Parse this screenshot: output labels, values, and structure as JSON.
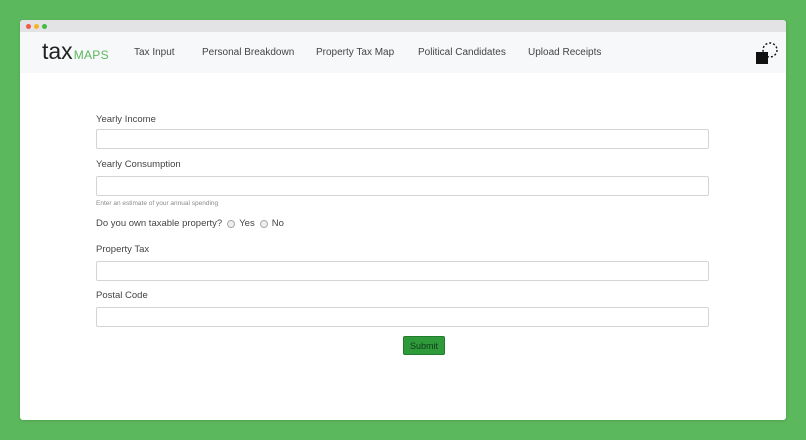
{
  "window": {
    "controls": [
      "close-icon",
      "minimize-icon",
      "maximize-icon"
    ]
  },
  "brand": {
    "tax": "tax",
    "maps": "MAPS",
    "accent_color": "#5cb85c"
  },
  "nav": {
    "items": [
      "Tax Input",
      "Personal Breakdown",
      "Property Tax Map",
      "Political Candidates",
      "Upload Receipts"
    ],
    "right_icon": "loading-spinner-icon"
  },
  "form": {
    "yearly_income": {
      "label": "Yearly Income",
      "value": ""
    },
    "yearly_consumption": {
      "label": "Yearly Consumption",
      "value": "",
      "hint": "Enter an estimate of your annual spending"
    },
    "property_question": {
      "label": "Do you own taxable property?",
      "options": [
        "Yes",
        "No"
      ]
    },
    "property_tax": {
      "label": "Property Tax",
      "value": ""
    },
    "postal_code": {
      "label": "Postal Code",
      "value": ""
    },
    "submit_label": "Submit",
    "submit_color": "#2e9a3a"
  }
}
